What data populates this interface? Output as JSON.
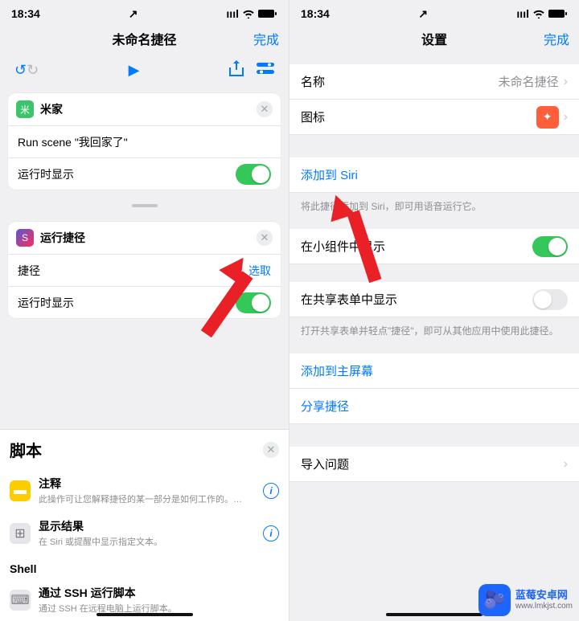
{
  "status": {
    "time": "18:34",
    "loc": "↗",
    "sig": "ıııl",
    "wifi": "✦",
    "batt": "▮"
  },
  "left": {
    "title": "未命名捷径",
    "done": "完成",
    "card1": {
      "app": "米家",
      "action": "Run scene \"我回家了\"",
      "show_label": "运行时显示"
    },
    "card2": {
      "app": "运行捷径",
      "shortcut_label": "捷径",
      "select": "选取",
      "show_label": "运行时显示"
    },
    "section": {
      "title": "脚本",
      "rows": [
        {
          "t1": "注释",
          "t2": "此操作可让您解释捷径的某一部分是如何工作的。…"
        },
        {
          "t1": "显示结果",
          "t2": "在 Siri 或提醒中显示指定文本。"
        }
      ],
      "sub": "Shell",
      "ssh": {
        "t1": "通过 SSH 运行脚本",
        "t2": "通过 SSH 在远程电脑上运行脚本。"
      }
    }
  },
  "right": {
    "title": "设置",
    "done": "完成",
    "name_label": "名称",
    "name_value": "未命名捷径",
    "icon_label": "图标",
    "siri_label": "添加到 Siri",
    "siri_hint": "将此捷径添加到 Siri，即可用语音运行它。",
    "widget_label": "在小组件中显示",
    "share_label": "在共享表单中显示",
    "share_hint": "打开共享表单并轻点\"捷径\"，即可从其他应用中使用此捷径。",
    "home_label": "添加到主屏幕",
    "share_shortcut": "分享捷径",
    "import_label": "导入问题"
  },
  "wm": {
    "name": "蓝莓安卓网",
    "url": "www.lmkjst.com"
  }
}
